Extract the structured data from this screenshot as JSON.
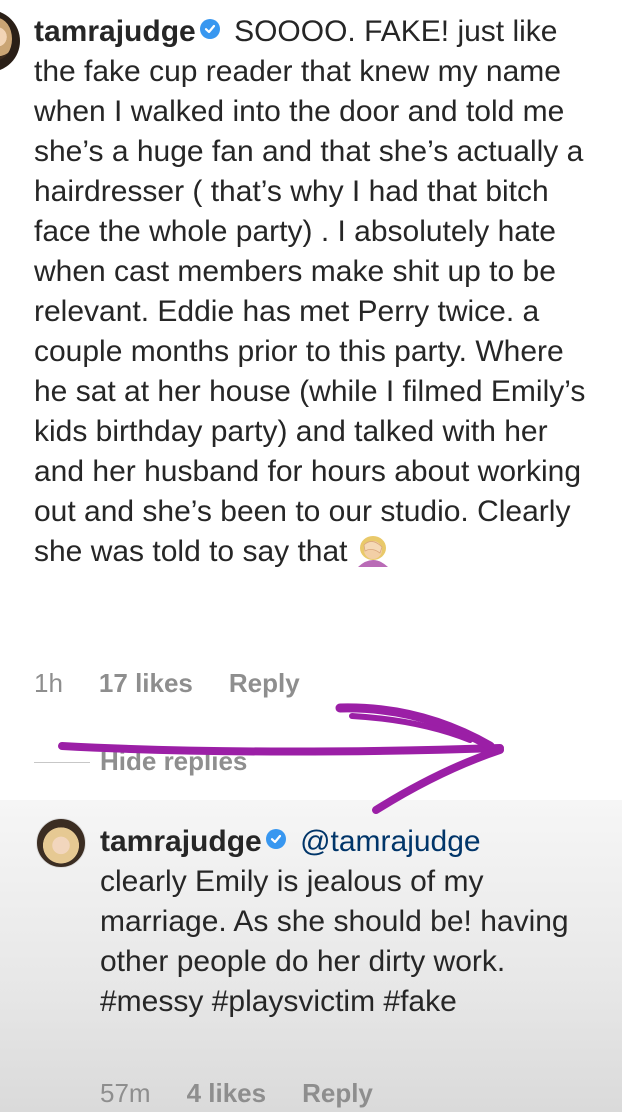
{
  "comment": {
    "username": "tamrajudge",
    "text": "SOOOO. FAKE!  just like the fake cup reader that knew my name when I walked into the door and told me she’s a huge fan and that she’s actually  a hairdresser ( that’s why I had that bitch face the whole party) .  I absolutely hate when cast members make shit up to be relevant.  Eddie has met Perry twice.  a couple months prior to this party.  Where he sat at her house (while I filmed Emily’s kids birthday party) and talked with her and her husband  for hours about working out and she’s been to our studio. Clearly she was told to say that",
    "emoji": "facepalm-icon",
    "time": "1h",
    "likes": "17 likes",
    "reply_label": "Reply"
  },
  "hide_replies_label": "Hide replies",
  "reply": {
    "username": "tamrajudge",
    "mention": "@tamrajudge",
    "text": "clearly Emily is jealous of my marriage.  As she should be! having other people do her dirty work. #messy #playsvictim #fake",
    "time": "57m",
    "likes": "4 likes",
    "reply_label": "Reply"
  },
  "colors": {
    "annotation_arrow": "#9b1fa6",
    "verified_badge": "#3897f0",
    "meta_text": "#8e8e8e"
  }
}
